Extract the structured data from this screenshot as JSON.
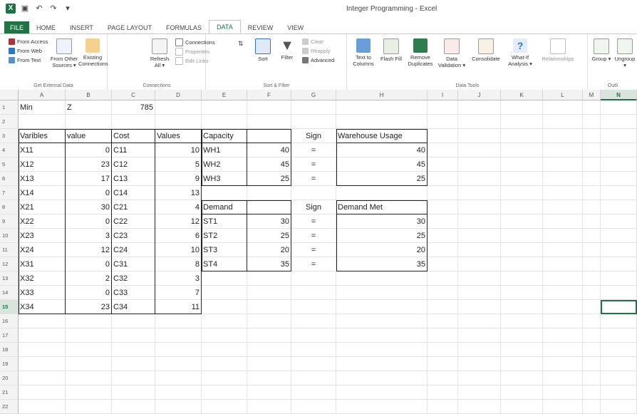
{
  "window": {
    "title": "Integer Programming - Excel"
  },
  "ribbon_tabs": [
    "FILE",
    "HOME",
    "INSERT",
    "PAGE LAYOUT",
    "FORMULAS",
    "DATA",
    "REVIEW",
    "VIEW"
  ],
  "active_tab": "DATA",
  "ribbon": {
    "get_external_data": {
      "label": "Get External Data",
      "from_access": "From Access",
      "from_web": "From Web",
      "from_text": "From Text",
      "from_other": "From Other Sources ▾",
      "existing": "Existing Connections"
    },
    "connections": {
      "label": "Connections",
      "refresh": "Refresh All ▾",
      "connections": "Connections",
      "properties": "Properties",
      "edit_links": "Edit Links"
    },
    "sort_filter": {
      "label": "Sort & Filter",
      "sort": "Sort",
      "filter": "Filter",
      "clear": "Clear",
      "reapply": "Reapply",
      "advanced": "Advanced"
    },
    "data_tools": {
      "label": "Data Tools",
      "text_to_columns": "Text to Columns",
      "flash_fill": "Flash Fill",
      "remove_duplicates": "Remove Duplicates",
      "data_validation": "Data Validation ▾",
      "consolidate": "Consolidate",
      "what_if": "What-If Analysis ▾",
      "relationships": "Relationships"
    },
    "outline": {
      "label": "Outli",
      "group": "Group ▾",
      "ungroup": "Ungroup ▾"
    }
  },
  "columns": [
    "A",
    "B",
    "C",
    "D",
    "E",
    "F",
    "G",
    "H",
    "I",
    "J",
    "K",
    "L",
    "M",
    "N"
  ],
  "selected_column": "N",
  "selected_row": "15",
  "rows": [
    "1",
    "2",
    "3",
    "4",
    "5",
    "6",
    "7",
    "8",
    "9",
    "10",
    "11",
    "12",
    "13",
    "14",
    "15",
    "16",
    "17",
    "18",
    "19",
    "20",
    "21",
    "22"
  ],
  "cells": {
    "A1": "Min",
    "B1": "Z",
    "C1": "785",
    "A3": "Varibles",
    "B3": "value",
    "C3": "Cost",
    "D3": "Values",
    "E3": "Capacity",
    "G3": "Sign",
    "H3": "Warehouse Usage",
    "A4": "X11",
    "B4": "0",
    "C4": "C11",
    "D4": "10",
    "E4": "WH1",
    "F4": "40",
    "G4": "=",
    "H4": "40",
    "A5": "X12",
    "B5": "23",
    "C5": "C12",
    "D5": "5",
    "E5": "WH2",
    "F5": "45",
    "G5": "=",
    "H5": "45",
    "A6": "X13",
    "B6": "17",
    "C6": "C13",
    "D6": "9",
    "E6": "WH3",
    "F6": "25",
    "G6": "=",
    "H6": "25",
    "A7": "X14",
    "B7": "0",
    "C7": "C14",
    "D7": "13",
    "A8": "X21",
    "B8": "30",
    "C8": "C21",
    "D8": "4",
    "E8": "Demand",
    "G8": "Sign",
    "H8": "Demand Met",
    "A9": "X22",
    "B9": "0",
    "C9": "C22",
    "D9": "12",
    "E9": "ST1",
    "F9": "30",
    "G9": "=",
    "H9": "30",
    "A10": "X23",
    "B10": "3",
    "C10": "C23",
    "D10": "6",
    "E10": "ST2",
    "F10": "25",
    "G10": "=",
    "H10": "25",
    "A11": "X24",
    "B11": "12",
    "C11": "C24",
    "D11": "10",
    "E11": "ST3",
    "F11": "20",
    "G11": "=",
    "H11": "20",
    "A12": "X31",
    "B12": "0",
    "C12": "C31",
    "D12": "8",
    "E12": "ST4",
    "F12": "35",
    "G12": "=",
    "H12": "35",
    "A13": "X32",
    "B13": "2",
    "C13": "C32",
    "D13": "3",
    "A14": "X33",
    "B14": "0",
    "C14": "C33",
    "D14": "7",
    "A15": "X34",
    "B15": "23",
    "C15": "C34",
    "D15": "11"
  }
}
